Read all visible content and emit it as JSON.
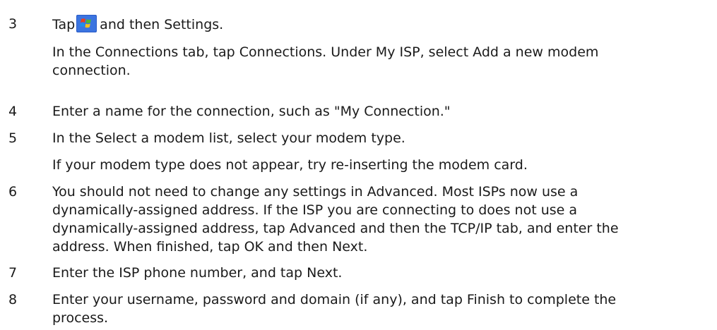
{
  "steps": [
    {
      "number": "3",
      "line1_before": "Tap",
      "icon": "windows-start-icon",
      "line1_after": "and then Settings.",
      "note_lines": [
        "In the Connections tab, tap Connections. Under My ISP, select Add a new modem",
        "connection."
      ]
    },
    {
      "number": "4",
      "lines": [
        "Enter a name for the connection, such as \"My Connection.\""
      ]
    },
    {
      "number": "5",
      "lines": [
        "In the Select a modem list, select your modem type."
      ],
      "note_lines": [
        "If your modem type does not appear, try re-inserting the modem card."
      ]
    },
    {
      "number": "6",
      "lines": [
        "You should not need to change any settings in Advanced. Most ISPs now use a",
        "dynamically-assigned address. If the ISP you are connecting to does not use a",
        "dynamically-assigned address, tap Advanced and then the TCP/IP tab, and enter the",
        "address. When finished, tap OK and then Next."
      ]
    },
    {
      "number": "7",
      "lines": [
        "Enter the ISP phone number, and tap Next."
      ]
    },
    {
      "number": "8",
      "lines": [
        "Enter your username, password and domain (if any), and tap Finish to complete the",
        "process."
      ]
    }
  ]
}
